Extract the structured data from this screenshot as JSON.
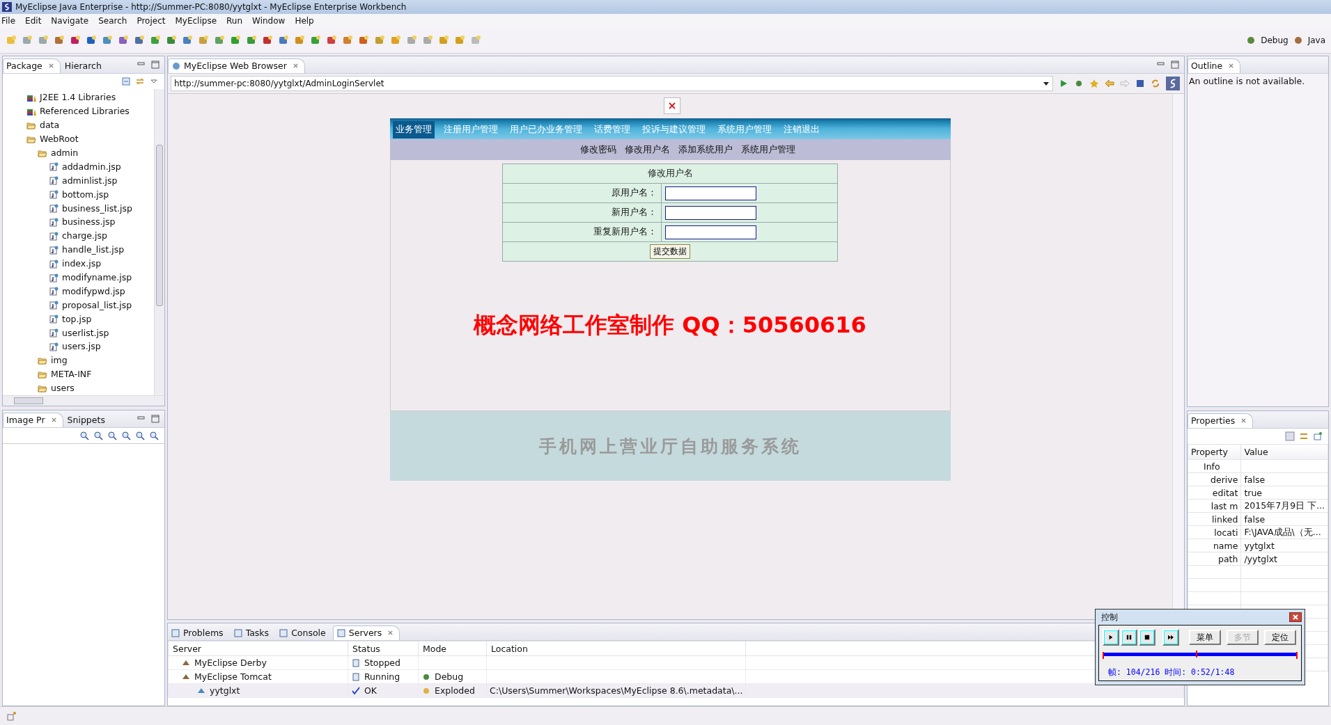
{
  "window": {
    "title": "MyEclipse Java Enterprise - http://Summer-PC:8080/yytglxt - MyEclipse Enterprise Workbench"
  },
  "menu": [
    "File",
    "Edit",
    "Navigate",
    "Search",
    "Project",
    "MyEclipse",
    "Run",
    "Window",
    "Help"
  ],
  "perspectives": [
    "Debug",
    "Java"
  ],
  "left_tabs": [
    {
      "label": "Package",
      "selected": true
    },
    {
      "label": "Hierarch",
      "selected": false
    }
  ],
  "tree": [
    {
      "label": "J2EE 1.4 Libraries",
      "kind": "library"
    },
    {
      "label": "Referenced Libraries",
      "kind": "library"
    },
    {
      "label": "data",
      "kind": "folder"
    },
    {
      "label": "WebRoot",
      "kind": "folder",
      "children": [
        {
          "label": "admin",
          "kind": "folder",
          "children": [
            {
              "label": "addadmin.jsp",
              "kind": "jsp"
            },
            {
              "label": "adminlist.jsp",
              "kind": "jsp"
            },
            {
              "label": "bottom.jsp",
              "kind": "jsp"
            },
            {
              "label": "business_list.jsp",
              "kind": "jsp"
            },
            {
              "label": "business.jsp",
              "kind": "jsp"
            },
            {
              "label": "charge.jsp",
              "kind": "jsp"
            },
            {
              "label": "handle_list.jsp",
              "kind": "jsp"
            },
            {
              "label": "index.jsp",
              "kind": "jsp"
            },
            {
              "label": "modifyname.jsp",
              "kind": "jsp"
            },
            {
              "label": "modifypwd.jsp",
              "kind": "jsp"
            },
            {
              "label": "proposal_list.jsp",
              "kind": "jsp"
            },
            {
              "label": "top.jsp",
              "kind": "jsp"
            },
            {
              "label": "userlist.jsp",
              "kind": "jsp"
            },
            {
              "label": "users.jsp",
              "kind": "jsp"
            }
          ]
        },
        {
          "label": "img",
          "kind": "folder"
        },
        {
          "label": "META-INF",
          "kind": "folder"
        },
        {
          "label": "users",
          "kind": "folder"
        }
      ]
    }
  ],
  "image_tabs": [
    {
      "label": "Image Pr",
      "selected": true
    },
    {
      "label": "Snippets",
      "selected": false
    }
  ],
  "browser": {
    "tab": "MyEclipse Web Browser",
    "url": "http://summer-pc:8080/yytglxt/AdminLoginServlet",
    "nav": [
      {
        "label": "业务管理",
        "selected": true
      },
      {
        "label": "注册用户管理",
        "selected": false
      },
      {
        "label": "用户已办业务管理",
        "selected": false
      },
      {
        "label": "话费管理",
        "selected": false
      },
      {
        "label": "投诉与建议管理",
        "selected": false
      },
      {
        "label": "系统用户管理",
        "selected": false
      },
      {
        "label": "注销退出",
        "selected": false
      }
    ],
    "subnav": [
      "修改密码",
      "修改用户名",
      "添加系统用户",
      "系统用户管理"
    ],
    "form": {
      "title": "修改用户名",
      "fields": [
        {
          "label": "原用户名："
        },
        {
          "label": "新用户名："
        },
        {
          "label": "重复新用户名："
        }
      ],
      "submit": "提交数据"
    },
    "notice": "概念网络工作室制作 QQ：50560616",
    "footer": "手机网上营业厅自助服务系统"
  },
  "bottom_tabs": [
    {
      "label": "Problems",
      "selected": false
    },
    {
      "label": "Tasks",
      "selected": false
    },
    {
      "label": "Console",
      "selected": false
    },
    {
      "label": "Servers",
      "selected": true
    }
  ],
  "servers": {
    "columns": [
      "Server",
      "Status",
      "Mode",
      "Location"
    ],
    "rows": [
      {
        "server": "MyEclipse Derby",
        "status": "Stopped",
        "selected": false
      },
      {
        "server": "MyEclipse Tomcat",
        "status": "Running",
        "mode": "Debug",
        "selected": false,
        "children": [
          {
            "server": "yytglxt",
            "status": "OK",
            "mode": "Exploded",
            "location": "C:\\Users\\Summer\\Workspaces\\MyEclipse 8.6\\.metadata\\...",
            "selected": true
          }
        ]
      }
    ]
  },
  "outline": {
    "tab": "Outline",
    "message": "An outline is not available."
  },
  "properties": {
    "tab": "Properties",
    "columns": [
      "Property",
      "Value"
    ],
    "category": "Info",
    "rows": [
      {
        "property": "derive",
        "value": "false"
      },
      {
        "property": "editat",
        "value": "true"
      },
      {
        "property": "last m",
        "value": "2015年7月9日 下..."
      },
      {
        "property": "linked",
        "value": "false"
      },
      {
        "property": "locati",
        "value": "F:\\JAVA成品\\（无..."
      },
      {
        "property": "name",
        "value": "yytglxt"
      },
      {
        "property": "path",
        "value": "/yytglxt"
      }
    ]
  },
  "player": {
    "title": "控制",
    "buttons": [
      {
        "label": "菜单",
        "disabled": false
      },
      {
        "label": "多节",
        "disabled": true
      },
      {
        "label": "定位",
        "disabled": false
      }
    ],
    "level": 0.48,
    "status": "帧: 104/216 时间: 0:52/1:48"
  }
}
